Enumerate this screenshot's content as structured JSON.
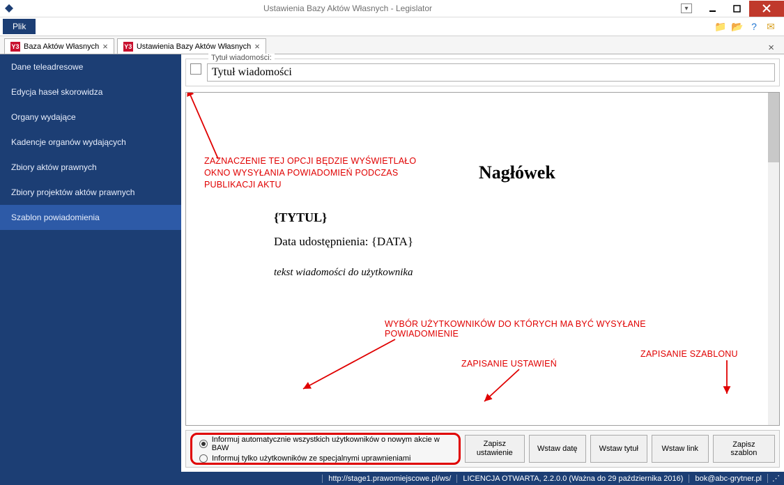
{
  "titlebar": {
    "title": "Ustawienia Bazy Aktów Własnych - Legislator"
  },
  "menu": {
    "plik": "Plik"
  },
  "tabs": [
    {
      "icon": "Y3",
      "label": "Baza Aktów Własnych"
    },
    {
      "icon": "Y3",
      "label": "Ustawienia Bazy Aktów Własnych"
    }
  ],
  "sidebar": {
    "items": [
      "Dane teleadresowe",
      "Edycja haseł skorowidza",
      "Organy wydające",
      "Kadencje organów wydających",
      "Zbiory aktów prawnych",
      "Zbiory projektów aktów prawnych",
      "Szablon powiadomienia"
    ],
    "activeIndex": 6
  },
  "topfield": {
    "legend": "Tytuł wiadomości:",
    "value": "Tytuł wiadomości"
  },
  "annotations": {
    "top": "ZAZNACZENIE TEJ OPCJI BĘDZIE WYŚWIETLAŁO\nOKNO WYSYŁANIA POWIADOMIEŃ PODCZAS\nPUBLIKACJI AKTU",
    "users": "WYBÓR UŻYTKOWNIKÓW DO KTÓRYCH MA BYĆ WYSYŁANE\nPOWIADOMIENIE",
    "saveSettings": "ZAPISANIE USTAWIEŃ",
    "saveTemplate": "ZAPISANIE SZABLONU"
  },
  "editor": {
    "header": "Nagłówek",
    "tytul": "{TYTUL}",
    "data": "Data udostępnienia: {DATA}",
    "tekst": "tekst wiadomości do użytkownika"
  },
  "radios": {
    "opt1": "Informuj automatycznie wszystkich użytkowników o nowym akcie w BAW",
    "opt2": "Informuj tylko użytkowników ze specjalnymi uprawnieniami",
    "selected": 0
  },
  "buttons": {
    "zapiszUst": "Zapisz ustawienie",
    "wstawDate": "Wstaw datę",
    "wstawTytul": "Wstaw tytuł",
    "wstawLink": "Wstaw link",
    "zapiszSzablon": "Zapisz szablon"
  },
  "status": {
    "url": "http://stage1.prawomiejscowe.pl/ws/",
    "license": "LICENCJA OTWARTA, 2.2.0.0 (Ważna do 29 października 2016)",
    "email": "bok@abc-grytner.pl"
  }
}
